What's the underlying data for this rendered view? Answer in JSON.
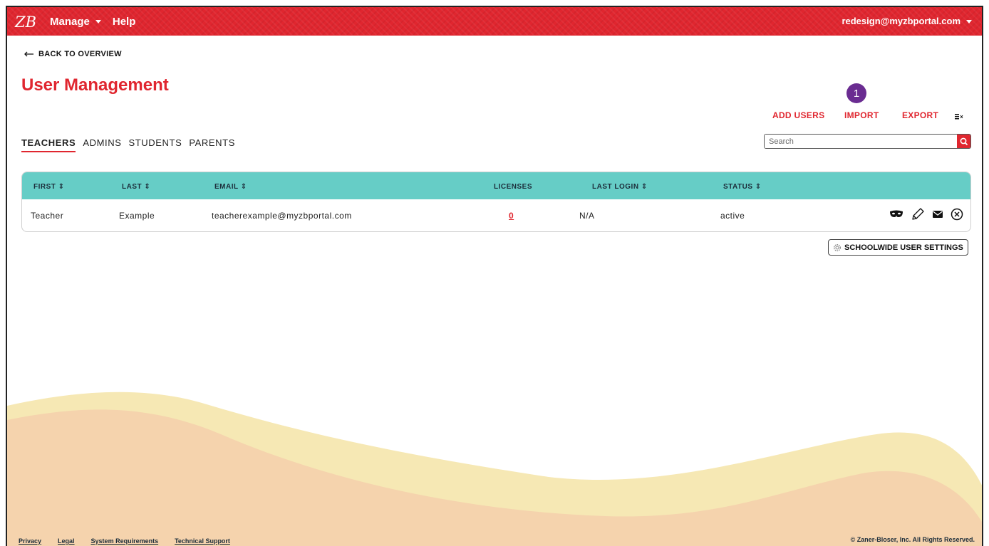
{
  "header": {
    "logo_text": "ZB",
    "nav": [
      "Manage",
      "Help"
    ],
    "user_email": "redesign@myzbportal.com"
  },
  "back_link": "BACK TO OVERVIEW",
  "page_title": "User Management",
  "annotation_badge": "1",
  "actions": {
    "add_users": "ADD USERS",
    "import": "IMPORT",
    "export": "EXPORT"
  },
  "tabs": [
    {
      "label": "TEACHERS",
      "active": true
    },
    {
      "label": "ADMINS",
      "active": false
    },
    {
      "label": "STUDENTS",
      "active": false
    },
    {
      "label": "PARENTS",
      "active": false
    }
  ],
  "search": {
    "placeholder": "Search"
  },
  "table": {
    "columns": [
      "FIRST",
      "LAST",
      "EMAIL",
      "LICENSES",
      "LAST LOGIN",
      "STATUS"
    ],
    "rows": [
      {
        "first": "Teacher",
        "last": "Example",
        "email": "teacherexample@myzbportal.com",
        "licenses": "0",
        "last_login": "N/A",
        "status": "active"
      }
    ]
  },
  "settings_button": "SCHOOLWIDE USER SETTINGS",
  "footer": {
    "links": [
      "Privacy",
      "Legal",
      "System Requirements",
      "Technical Support"
    ],
    "copyright": "© Zaner-Bloser, Inc. All Rights Reserved."
  },
  "colors": {
    "brand_red": "#e0262f",
    "table_header": "#66cdc6",
    "badge_purple": "#6a2c91",
    "wave_yellow": "#f6e8b4",
    "wave_peach": "#f5d3ad"
  }
}
